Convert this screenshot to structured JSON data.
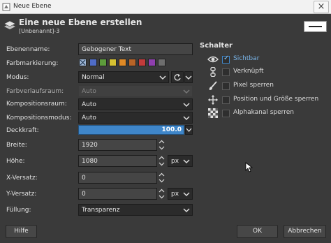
{
  "window": {
    "title": "Neue Ebene",
    "close_glyph": "×"
  },
  "header": {
    "title": "Eine neue Ebene erstellen",
    "subtitle": "[Unbenannt]-3"
  },
  "form": {
    "layer_name_label": "Ebenenname:",
    "layer_name_value": "Gebogener Text",
    "color_tag_label": "Farbmarkierung:",
    "color_tags": [
      "none",
      "#4f6cc7",
      "#5d9c3b",
      "#d6c132",
      "#e08a26",
      "#b86427",
      "#c23b3b",
      "#8f3fae",
      "#6e6e6e"
    ],
    "mode_label": "Modus:",
    "mode_value": "Normal",
    "blend_space_label": "Farbverlaufsraum:",
    "blend_space_value": "Auto",
    "composite_space_label": "Kompositionsraum:",
    "composite_space_value": "Auto",
    "composite_mode_label": "Kompositionsmodus:",
    "composite_mode_value": "Auto",
    "opacity_label": "Deckkraft:",
    "opacity_value": "100.0",
    "opacity_fraction": 1.0,
    "width_label": "Breite:",
    "width_value": "1920",
    "height_label": "Höhe:",
    "height_value": "1080",
    "size_unit": "px",
    "offset_x_label": "X-Versatz:",
    "offset_x_value": "0",
    "offset_y_label": "Y-Versatz:",
    "offset_y_value": "0",
    "offset_unit": "px",
    "fill_label": "Füllung:",
    "fill_value": "Transparenz"
  },
  "switches": {
    "title": "Schalter",
    "items": [
      {
        "label": "Sichtbar",
        "checked": true,
        "icon": "eye-icon"
      },
      {
        "label": "Verknüpft",
        "checked": false,
        "icon": "chain-icon"
      },
      {
        "label": "Pixel sperren",
        "checked": false,
        "icon": "paintbrush-icon"
      },
      {
        "label": "Position und Größe sperren",
        "checked": false,
        "icon": "move-arrows-icon"
      },
      {
        "label": "Alphakanal sperren",
        "checked": false,
        "icon": "checkerboard-icon"
      }
    ],
    "check_glyph": "✓"
  },
  "buttons": {
    "help": "Hilfe",
    "ok": "OK",
    "cancel": "Abbrechen"
  },
  "colors": {
    "accent": "#3f86c9",
    "background": "#3a3a3a",
    "field": "#2a2a2a",
    "checked_text": "#79b5ea"
  }
}
